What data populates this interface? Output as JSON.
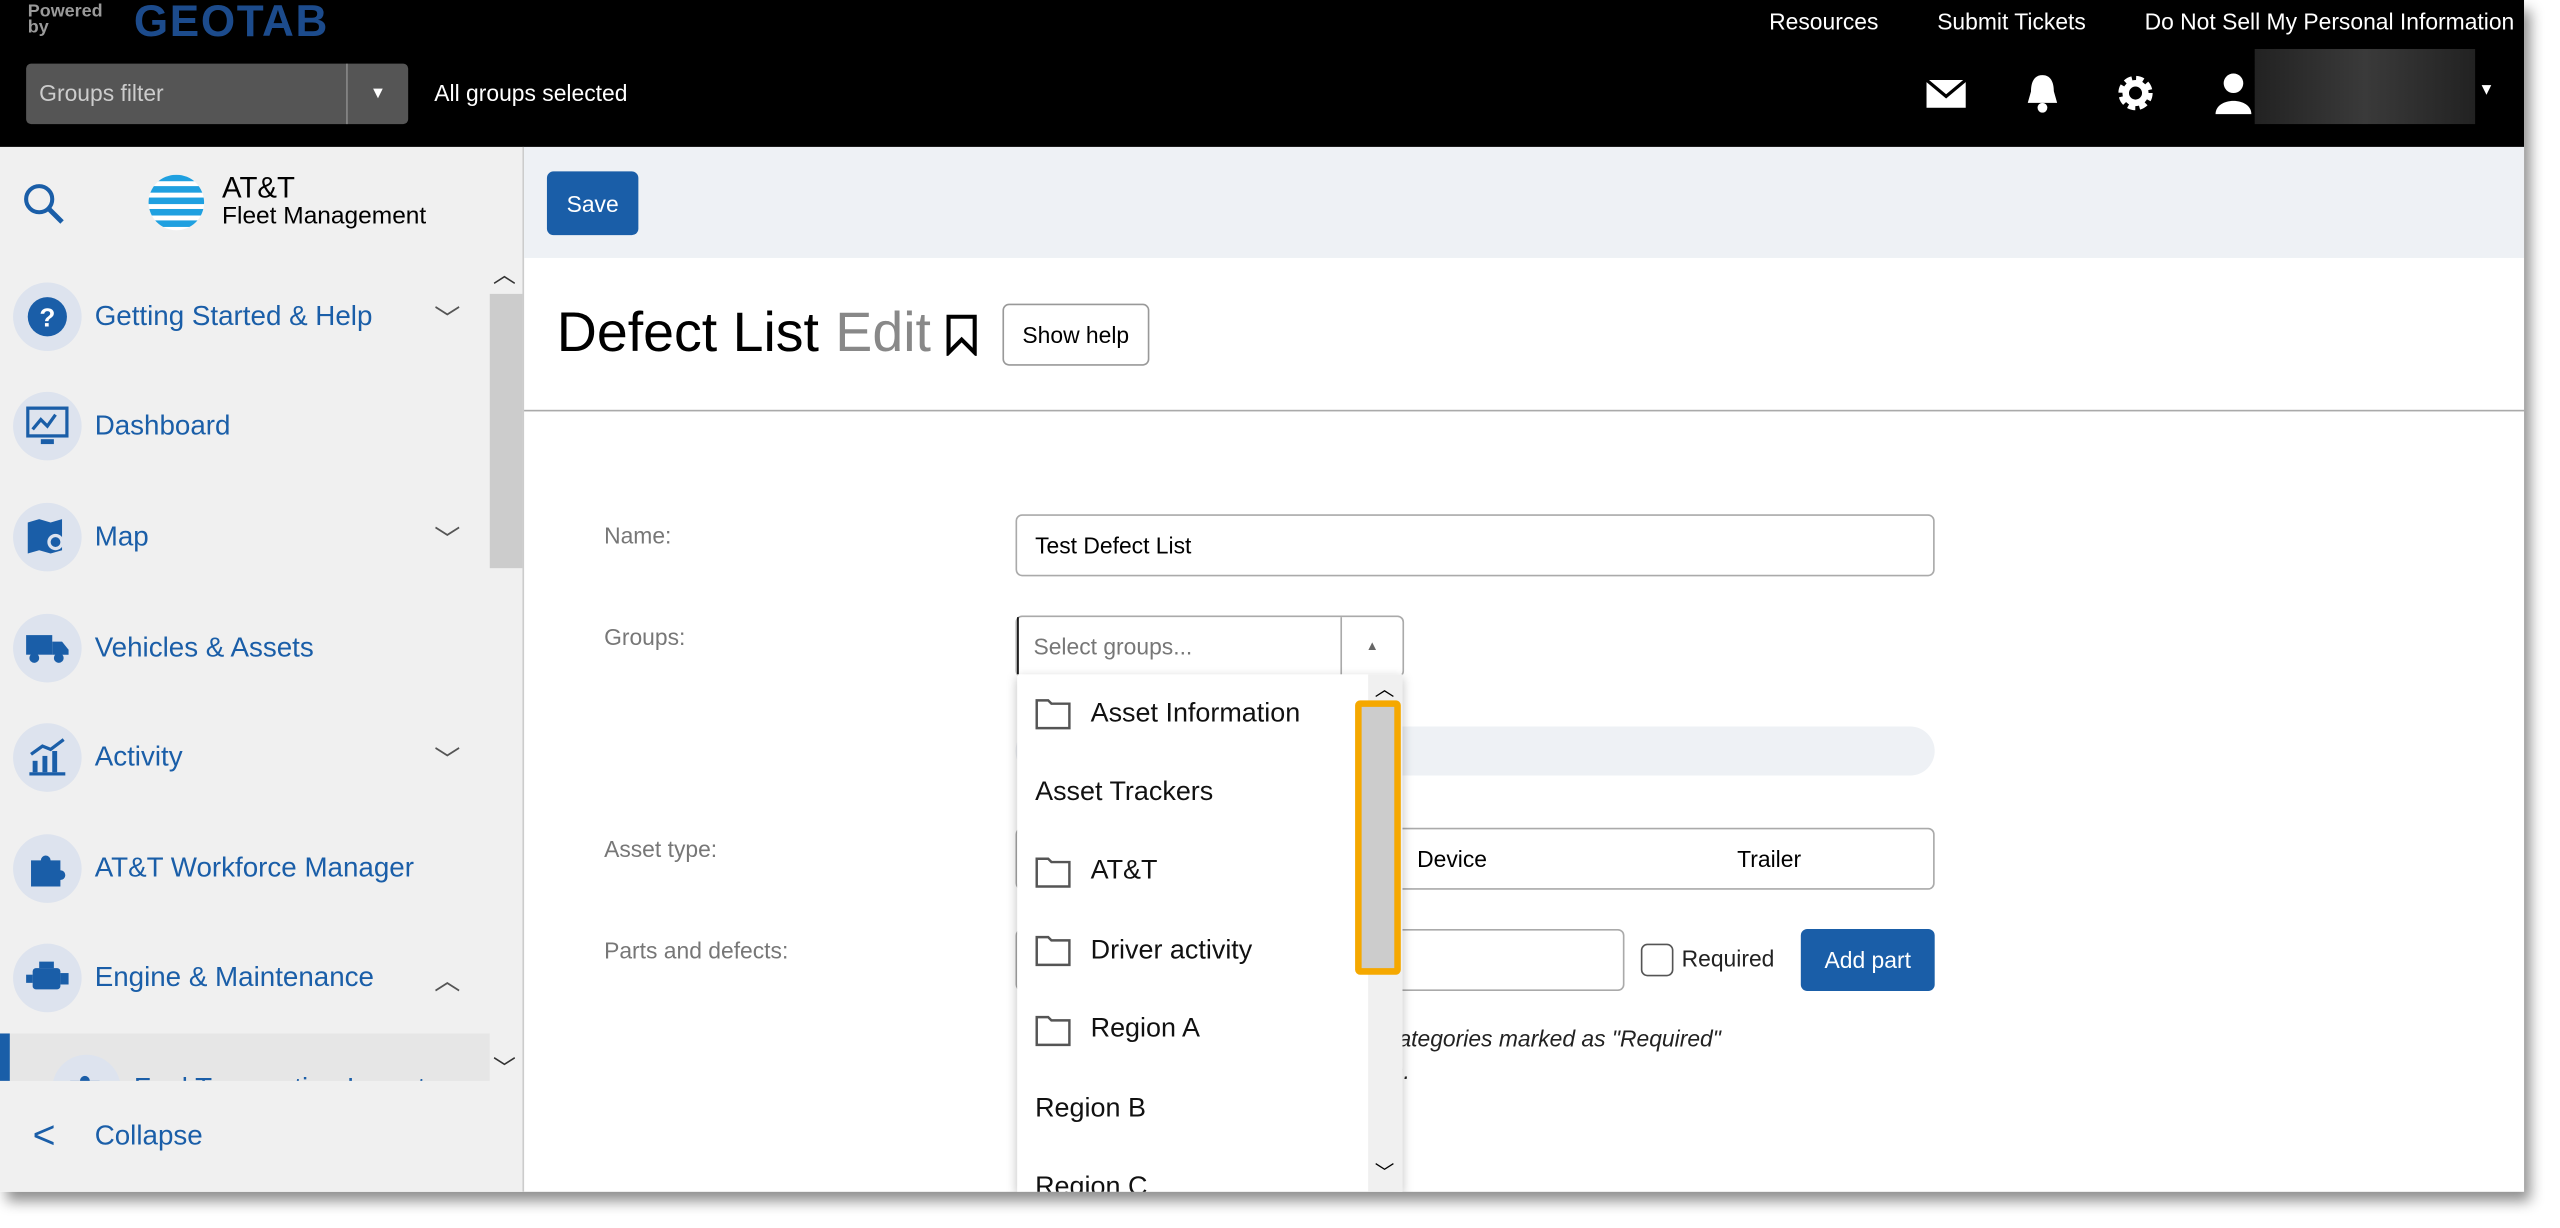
{
  "topbar": {
    "powered_by": "Powered by",
    "brand": "GEOTAB",
    "links": [
      "Resources",
      "Submit Tickets",
      "Do Not Sell My Personal Information"
    ],
    "groups_filter_placeholder": "Groups filter",
    "groups_status": "All groups selected",
    "icons": [
      "mail-icon",
      "bell-icon",
      "gear-icon",
      "user-icon"
    ]
  },
  "sidebar": {
    "logo_line1": "AT&T",
    "logo_line2": "Fleet Management",
    "items": [
      {
        "label": "Getting Started & Help",
        "icon": "help-icon",
        "expandable": true,
        "expanded": false
      },
      {
        "label": "Dashboard",
        "icon": "dashboard-icon",
        "expandable": false
      },
      {
        "label": "Map",
        "icon": "map-icon",
        "expandable": true,
        "expanded": false
      },
      {
        "label": "Vehicles & Assets",
        "icon": "truck-icon",
        "expandable": false
      },
      {
        "label": "Activity",
        "icon": "activity-chart-icon",
        "expandable": true,
        "expanded": false
      },
      {
        "label": "AT&T Workforce Manager",
        "icon": "puzzle-icon",
        "expandable": false
      },
      {
        "label": "Engine & Maintenance",
        "icon": "engine-icon",
        "expandable": true,
        "expanded": true
      },
      {
        "label": "Fuel Transaction Import",
        "icon": "puzzle-icon",
        "expandable": false
      }
    ],
    "collapse_label": "Collapse"
  },
  "toolbar": {
    "save_label": "Save"
  },
  "page": {
    "title": "Defect List",
    "title_mode": "Edit",
    "show_help": "Show help"
  },
  "form": {
    "name_label": "Name:",
    "name_value": "Test Defect List",
    "groups_label": "Groups:",
    "groups_placeholder": "Select groups...",
    "asset_type_label": "Asset type:",
    "asset_types": [
      "Device",
      "Trailer"
    ],
    "parts_label": "Parts and defects:",
    "required_label": "Required",
    "required_checked": false,
    "add_part": "Add part",
    "note_line1": "r categories marked as \"Required\"",
    "note_line2": "ion."
  },
  "groups_dropdown": {
    "items": [
      {
        "label": "Asset Information",
        "folder": true
      },
      {
        "label": "Asset Trackers",
        "folder": false
      },
      {
        "label": "AT&T",
        "folder": true
      },
      {
        "label": "Driver activity",
        "folder": true
      },
      {
        "label": "Region A",
        "folder": true
      },
      {
        "label": "Region B",
        "folder": false
      },
      {
        "label": "Region C",
        "folder": false
      }
    ]
  },
  "colors": {
    "accent": "#1a5ea8",
    "highlight": "#f5a800"
  }
}
